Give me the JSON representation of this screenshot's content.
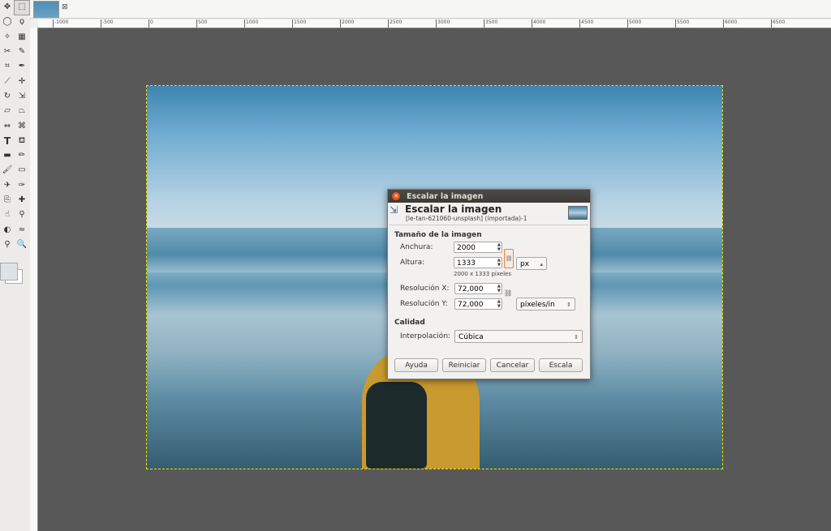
{
  "tab": {
    "close_icon": "close-icon"
  },
  "ruler": {
    "top_labels": [
      "-1000",
      "-500",
      "0",
      "500",
      "1000",
      "1500",
      "2000",
      "2500",
      "3000",
      "3500",
      "4000",
      "4500",
      "5000",
      "5500",
      "6000",
      "6500"
    ]
  },
  "dialog": {
    "window_title": "Escalar la imagen",
    "header_title": "Escalar la imagen",
    "header_subtitle": "[le-tan-621060-unsplash] (importada)-1",
    "image_size": {
      "section_label": "Tamaño de la imagen",
      "width_label": "Anchura:",
      "width_value": "2000",
      "height_label": "Altura:",
      "height_value": "1333",
      "size_info": "2000 x 1333 píxeles",
      "unit": "px",
      "resx_label": "Resolución X:",
      "resx_value": "72,000",
      "resy_label": "Resolución Y:",
      "resy_value": "72,000",
      "res_unit": "píxeles/in"
    },
    "quality": {
      "section_label": "Calidad",
      "interp_label": "Interpolación:",
      "interp_value": "Cúbica"
    },
    "buttons": {
      "help": "Ayuda",
      "reset": "Reiniciar",
      "cancel": "Cancelar",
      "scale": "Escala"
    }
  },
  "colors": {
    "accent": "#e95420",
    "canvas": "#585858",
    "titlebar": "#3c3b37"
  }
}
